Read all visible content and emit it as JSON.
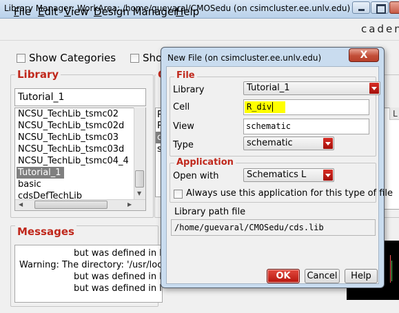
{
  "main_window": {
    "title": "Library Manager: WorkArea: /home/guevaral/CMOSedu (on csimcluster.ee.unlv.edu)",
    "brand": "caden",
    "menu": [
      {
        "key": "F",
        "rest": "ile"
      },
      {
        "key": "E",
        "rest": "dit"
      },
      {
        "key": "V",
        "rest": "iew"
      },
      {
        "key": "D",
        "rest": "esign Manager"
      },
      {
        "key": "H",
        "rest": "elp"
      }
    ],
    "show_categories_label": "Show Categories",
    "show_other_label_partial": "Show",
    "library_panel": {
      "title": "Library",
      "filter_value": "Tutorial_1",
      "items": [
        "NCSU_TechLib_tsmc02",
        "NCSU_TechLib_tsmc02d",
        "NCSU_TechLib_tsmc03",
        "NCSU_TechLib_tsmc03d",
        "NCSU_TechLib_tsmc04_4",
        "Tutorial_1",
        "basic",
        "cdsDefTechLib"
      ],
      "selected_index": 5
    },
    "category_panel_title_partial": "C",
    "category_items_partial": [
      "P",
      "P",
      "c",
      "s"
    ],
    "right_peek_header": "L",
    "messages_panel": {
      "title": "Messages",
      "lines": [
        "but was defined in li",
        "Warning: The directory: '/usr/loc",
        "but was defined in li",
        "but was defined in li"
      ]
    }
  },
  "dialog": {
    "title": "New File (on csimcluster.ee.unlv.edu)",
    "close_label": "X",
    "file_group": {
      "title": "File",
      "library_label": "Library",
      "library_value": "Tutorial_1",
      "cell_label": "Cell",
      "cell_value": "R_div",
      "view_label": "View",
      "view_value": "schematic",
      "type_label": "Type",
      "type_value": "schematic"
    },
    "application_group": {
      "title": "Application",
      "open_with_label": "Open with",
      "open_with_value": "Schematics L",
      "always_use_label": "Always use this application for this type of file",
      "always_use_checked": false
    },
    "library_path_label": "Library path file",
    "library_path_value": "/home/guevaral/CMOSedu/cds.lib",
    "buttons": {
      "ok": "OK",
      "cancel": "Cancel",
      "help": "Help"
    }
  },
  "colors": {
    "group_title_red": "#c0281c",
    "ok_button": "#c8201a",
    "cell_highlight": "#ffff00",
    "titlebar": "#b9d1ea",
    "dialog_frame": "#c9dcef"
  }
}
